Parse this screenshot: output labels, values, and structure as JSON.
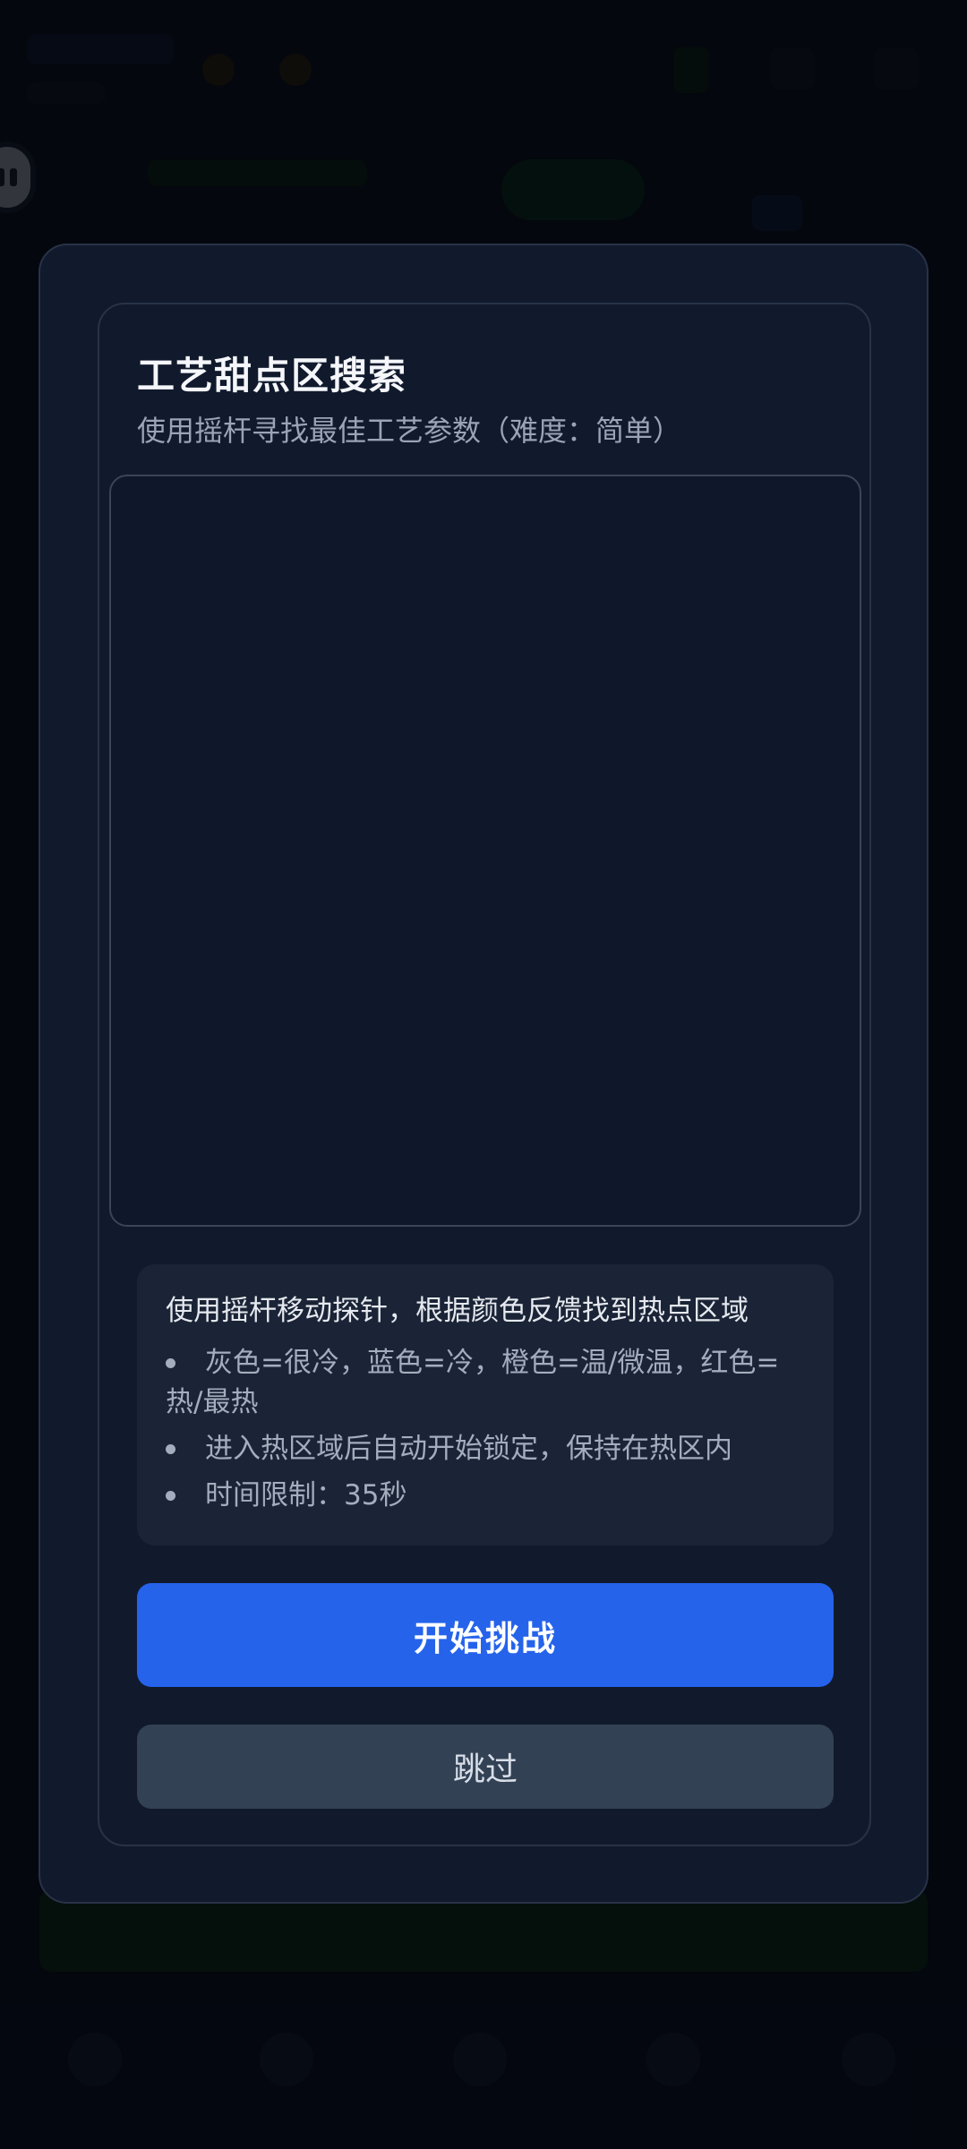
{
  "dialog": {
    "title": "工艺甜点区搜索",
    "subtitle": "使用摇杆寻找最佳工艺参数（难度：简单）",
    "instructions": {
      "lead": "使用摇杆移动探针，根据颜色反馈找到热点区域",
      "items": [
        "灰色=很冷，蓝色=冷，橙色=温/微温，红色=热/最热",
        "进入热区域后自动开始锁定，保持在热区内",
        "时间限制：35秒"
      ]
    },
    "start_label": "开始挑战",
    "skip_label": "跳过"
  },
  "colors": {
    "modal_bg": "#111a2c",
    "canvas_bg": "#0f172a",
    "primary": "#2563eb",
    "secondary": "#334155"
  }
}
